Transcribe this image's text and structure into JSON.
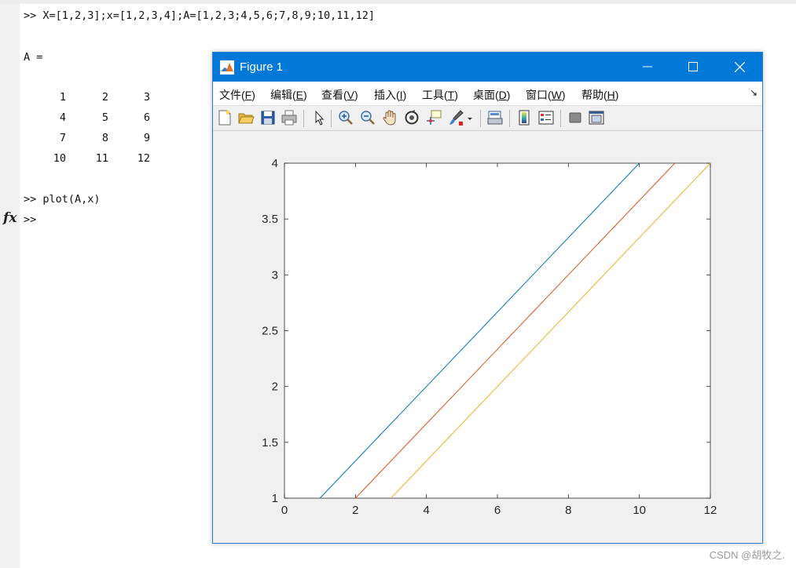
{
  "console": {
    "lines": [
      ">> X=[1,2,3];x=[1,2,3,4];A=[1,2,3;4,5,6;7,8,9;10,11,12]",
      "A =",
      ">> plot(A,x)",
      ">>"
    ],
    "matrix": [
      [
        "1",
        "2",
        "3"
      ],
      [
        "4",
        "5",
        "6"
      ],
      [
        "7",
        "8",
        "9"
      ],
      [
        "10",
        "11",
        "12"
      ]
    ],
    "fx_label": "fx"
  },
  "figure": {
    "title": "Figure 1",
    "menu": [
      {
        "label": "文件(",
        "key": "F",
        "end": ")"
      },
      {
        "label": "编辑(",
        "key": "E",
        "end": ")"
      },
      {
        "label": "查看(",
        "key": "V",
        "end": ")"
      },
      {
        "label": "插入(",
        "key": "I",
        "end": ")"
      },
      {
        "label": "工具(",
        "key": "T",
        "end": ")"
      },
      {
        "label": "桌面(",
        "key": "D",
        "end": ")"
      },
      {
        "label": "窗口(",
        "key": "W",
        "end": ")"
      },
      {
        "label": "帮助(",
        "key": "H",
        "end": ")"
      }
    ],
    "menu_overflow": "↘",
    "toolbar_icons": [
      "new-figure-icon",
      "open-file-icon",
      "save-icon",
      "print-icon",
      "pointer-icon",
      "zoom-in-icon",
      "zoom-out-icon",
      "pan-hand-icon",
      "rotate-3d-icon",
      "data-cursor-icon",
      "brush-icon",
      "print-preview-icon",
      "colorbar-icon",
      "legend-icon",
      "hide-plot-tools-icon",
      "show-plot-tools-icon"
    ]
  },
  "chart_data": {
    "type": "line",
    "title": "",
    "xlabel": "",
    "ylabel": "",
    "xlim": [
      0,
      12
    ],
    "ylim": [
      1,
      4
    ],
    "xticks": [
      "0",
      "2",
      "4",
      "6",
      "8",
      "10",
      "12"
    ],
    "yticks": [
      "1",
      "1.5",
      "2",
      "2.5",
      "3",
      "3.5",
      "4"
    ],
    "grid": false,
    "series": [
      {
        "x": [
          1,
          4,
          7,
          10
        ],
        "y": [
          1,
          2,
          3,
          4
        ],
        "color": "#0072bd"
      },
      {
        "x": [
          2,
          5,
          8,
          11
        ],
        "y": [
          1,
          2,
          3,
          4
        ],
        "color": "#d95319"
      },
      {
        "x": [
          3,
          6,
          9,
          12
        ],
        "y": [
          1,
          2,
          3,
          4
        ],
        "color": "#edb120"
      }
    ]
  },
  "watermark": "CSDN @胡牧之."
}
